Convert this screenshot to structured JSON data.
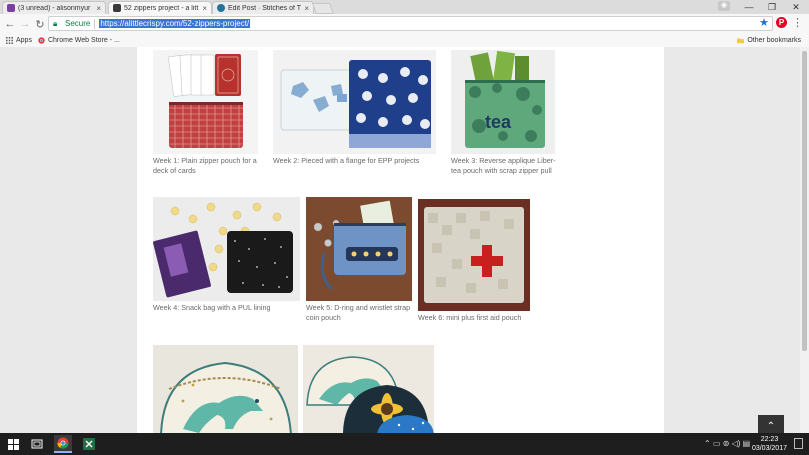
{
  "browser": {
    "tabs": [
      {
        "label": "(3 unread) - alisonmyur",
        "active": false,
        "icon": "mail-icon"
      },
      {
        "label": "52 zippers project - a litt",
        "active": true,
        "icon": "site-icon"
      },
      {
        "label": "Edit Post · Stitches of Ti",
        "active": false,
        "icon": "wordpress-icon"
      }
    ],
    "tab_close": "×",
    "window_controls": {
      "minimize": "—",
      "maximize": "❐",
      "close": "✕"
    },
    "nav": {
      "back": "←",
      "forward": "→",
      "reload": "↻"
    },
    "secure_label": "Secure",
    "url": "https://alittlecrispy.com/52-zippers-project/",
    "star": "★",
    "pinterest": "P",
    "menu": "⋮"
  },
  "bookmarks": {
    "apps_label": "Apps",
    "items": [
      {
        "label": "Chrome Web Store - ..."
      }
    ],
    "other_label": "Other bookmarks"
  },
  "gallery": {
    "items": [
      {
        "caption_l1": "Week 1: Plain zipper pouch for a",
        "caption_l2": "deck of cards"
      },
      {
        "caption_l1": "Week 2: Pieced with a flange for EPP projects",
        "caption_l2": ""
      },
      {
        "caption_l1": "Week 3: Reverse applique Liber-",
        "caption_l2": "tea pouch with scrap zipper pull"
      },
      {
        "caption_l1": "Week 4: Snack bag with a PUL lining",
        "caption_l2": ""
      },
      {
        "caption_l1": "Week 5: D-ring and wristlet strap",
        "caption_l2": "coin pouch"
      },
      {
        "caption_l1": "Week 6: mini plus first aid pouch",
        "caption_l2": ""
      },
      {
        "caption_l1": "",
        "caption_l2": ""
      },
      {
        "caption_l1": "",
        "caption_l2": ""
      }
    ],
    "tea_text": "tea"
  },
  "go_top": "⌃",
  "taskbar": {
    "time": "22:23",
    "date": "03/03/2017",
    "tray_icons": "⌃  ▭  ⊚  ◁)  ▤"
  },
  "colors": {
    "accent": "#3875d7",
    "secure": "#0b8043",
    "red_cross": "#c8201e"
  }
}
